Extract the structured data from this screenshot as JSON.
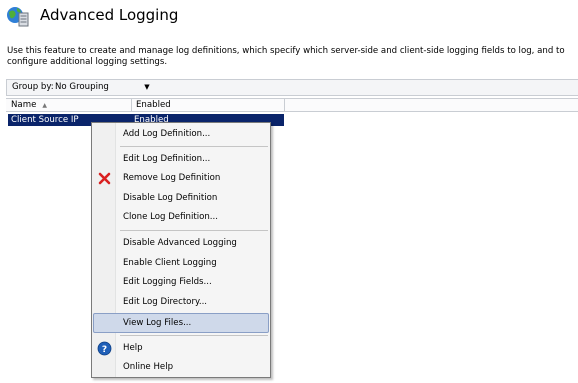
{
  "header": {
    "title": "Advanced Logging",
    "description": "Use this feature to create and manage log definitions, which specify which server-side and client-side logging fields to log, and to configure additional logging settings."
  },
  "groupbar": {
    "label": "Group by:",
    "selected": "No Grouping"
  },
  "list": {
    "columns": [
      "Name",
      "Enabled"
    ],
    "rows": [
      {
        "name": "Client Source IP",
        "enabled": "Enabled"
      }
    ]
  },
  "context_menu": {
    "items": [
      {
        "label": "Add Log Definition...",
        "icon": ""
      },
      {
        "label": "Edit Log Definition...",
        "icon": ""
      },
      {
        "label": "Remove Log Definition",
        "icon": "red-x-icon"
      },
      {
        "label": "Disable Log Definition",
        "icon": ""
      },
      {
        "label": "Clone Log Definition...",
        "icon": ""
      },
      {
        "label": "Disable Advanced Logging",
        "icon": ""
      },
      {
        "label": "Enable Client Logging",
        "icon": ""
      },
      {
        "label": "Edit Logging Fields...",
        "icon": ""
      },
      {
        "label": "Edit Log Directory...",
        "icon": ""
      },
      {
        "label": "View Log Files...",
        "icon": "",
        "highlighted": true
      },
      {
        "label": "Help",
        "icon": "help-icon"
      },
      {
        "label": "Online Help",
        "icon": ""
      }
    ]
  },
  "colors": {
    "selection": "#0a246a",
    "menu_highlight": "#cfd9ea",
    "remove_icon": "#d92020",
    "help_icon": "#1f5fb8"
  }
}
